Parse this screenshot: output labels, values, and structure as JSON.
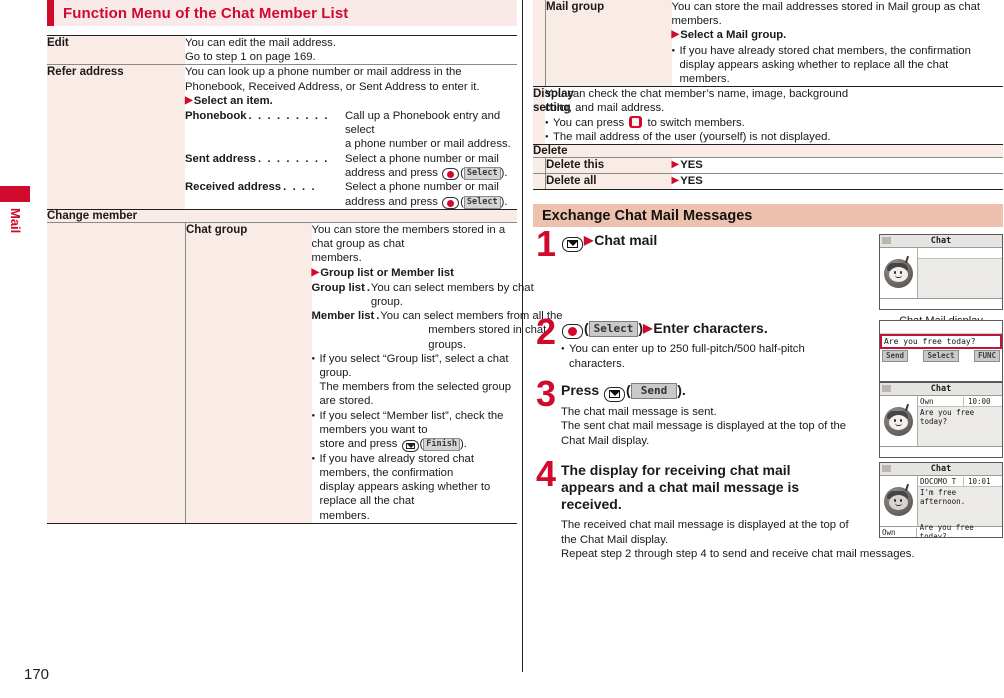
{
  "side_tab": {
    "label": "Mail"
  },
  "page_number": "170",
  "left": {
    "section_title": "Function Menu of the Chat Member List",
    "rows": [
      {
        "label": "Edit",
        "lines": [
          "You can edit the mail address.",
          "Go to step 1 on page 169."
        ]
      },
      {
        "label": "Refer address",
        "lines": [
          "You can look up a phone number or mail address in the",
          "Phonebook, Received Address, or Sent Address to enter it."
        ],
        "arrow_line": "Select an item.",
        "defs": [
          {
            "term": "Phonebook",
            "body": [
              "Call up a Phonebook entry and select",
              "a phone number or mail address."
            ]
          },
          {
            "term": "Sent address",
            "body_pre": "Select a phone number or mail",
            "body_post_pre": "address and press ",
            "body_post_suf": ".",
            "key": "center-key",
            "softkey": "Select"
          },
          {
            "term": "Received address",
            "body_pre": "Select a phone number or mail",
            "body_post_pre": "address and press ",
            "body_post_suf": ".",
            "key": "center-key",
            "softkey": "Select"
          }
        ]
      }
    ],
    "group_header": "Change member",
    "chat_group": {
      "label": "Chat group",
      "lines": [
        "You can store the members stored in a chat group as chat",
        "members."
      ],
      "arrow_line": "Group list or Member list",
      "defs": [
        {
          "term": "Group list",
          "body": [
            "You can select members by chat group."
          ]
        },
        {
          "term": "Member list",
          "body": [
            "You can select members from all the",
            "members stored in chat groups."
          ]
        }
      ],
      "bullets": [
        [
          "If you select “Group list”, select a chat group.",
          "The members from the selected group are stored."
        ],
        [
          "If you select “Member list”, check the members you want to",
          "store and press "
        ],
        [
          "If you have already stored chat members, the confirmation",
          "display appears asking whether to replace all the chat",
          "members."
        ]
      ],
      "finish_softkey": "Finish"
    }
  },
  "right": {
    "mail_group": {
      "label": "Mail group",
      "lines": [
        "You can store the mail addresses stored in Mail group as chat",
        "members."
      ],
      "arrow_line": "Select a Mail group.",
      "bullets": [
        [
          "If you have already stored chat members, the confirmation",
          "display appears asking whether to replace all the chat",
          "members."
        ]
      ]
    },
    "display_setting": {
      "label": "Display setting",
      "lines": [
        "You can check the chat member’s name, image, background",
        "color, and mail address."
      ],
      "bullet1_pre": "You can press ",
      "bullet1_post": " to switch members.",
      "bullet2": "The mail address of the user (yourself) is not displayed."
    },
    "delete": {
      "group_header": "Delete",
      "rows": [
        {
          "label": "Delete this",
          "value": "YES"
        },
        {
          "label": "Delete all",
          "value": "YES"
        }
      ]
    },
    "exchange": {
      "section_title": "Exchange Chat Mail Messages",
      "steps": [
        {
          "num": "1",
          "key": "mail-key",
          "head": "Chat mail",
          "shot": {
            "title": "Chat",
            "caption": "Chat Mail display",
            "who": "",
            "time": "",
            "text": "",
            "foot_own": "",
            "foot_text": ""
          }
        },
        {
          "num": "2",
          "key": "center-key",
          "softkey": "Select",
          "head": "Enter characters.",
          "bullets": [
            [
              "You can enter up to 250 full-pitch/500 half-pitch",
              "characters."
            ]
          ],
          "edit_shot": {
            "input_text": "Are you free today?",
            "left_key": "Send",
            "center_key": "Select",
            "right_key": "FUNC"
          }
        },
        {
          "num": "3",
          "head_pre": "Press ",
          "key": "mail-key",
          "softkey": "Send",
          "head_suf": ".",
          "subs": [
            "The chat mail message is sent.",
            "The sent chat mail message is displayed at the top of the",
            "Chat Mail display."
          ],
          "shot": {
            "title": "Chat",
            "who": "Own",
            "time": "10:00",
            "text": "Are you free today?",
            "foot_own": "",
            "foot_text": ""
          }
        },
        {
          "num": "4",
          "head_lines": [
            "The display for receiving chat mail",
            "appears and a chat mail message is",
            "received."
          ],
          "subs": [
            "The received chat mail message is displayed at the top of",
            "the Chat Mail display.",
            "Repeat step 2 through step 4 to send and receive chat mail messages."
          ],
          "shot": {
            "title": "Chat",
            "who": "DOCOMO T",
            "time": "10:01",
            "text": "I'm free afternoon.",
            "foot_own": "Own",
            "foot_text": "Are you free today?"
          }
        }
      ]
    }
  },
  "colors": {
    "brand_red": "#cf0a2c",
    "label_bg": "#f9ebe6",
    "section_bg": "#fae9e9",
    "exchange_bg": "#eec0ae"
  }
}
